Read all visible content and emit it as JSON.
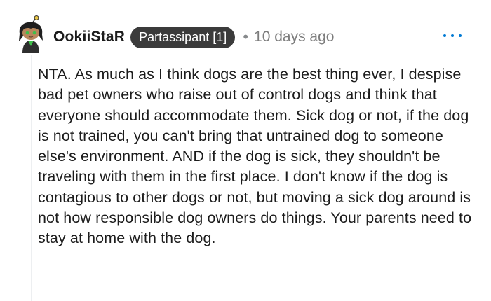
{
  "comment": {
    "author": {
      "username": "OokiiStaR",
      "flair": "Partassipant [1]",
      "avatar_icon": "snoo-avatar-icon"
    },
    "separator": "•",
    "timestamp": "10 days ago",
    "more_options_icon": "ellipsis-horizontal-icon",
    "body": "NTA. As much as I think dogs are the best thing ever, I despise bad pet owners who raise out of control dogs and think that everyone should accommodate them. Sick dog or not, if the dog is not trained, you can't bring that untrained dog to someone else's environment. AND if the dog is sick, they shouldn't be traveling with them in the first place. I don't know if the dog is contagious to other dogs or not, but moving a sick dog around is not how responsible dog owners do things. Your parents need to stay at home with the dog."
  },
  "colors": {
    "flair_bg": "#3b3b3b",
    "flair_text": "#ffffff",
    "meta_text": "#7c7c7c",
    "accent": "#0079d3",
    "thread_line": "#edeff1"
  }
}
